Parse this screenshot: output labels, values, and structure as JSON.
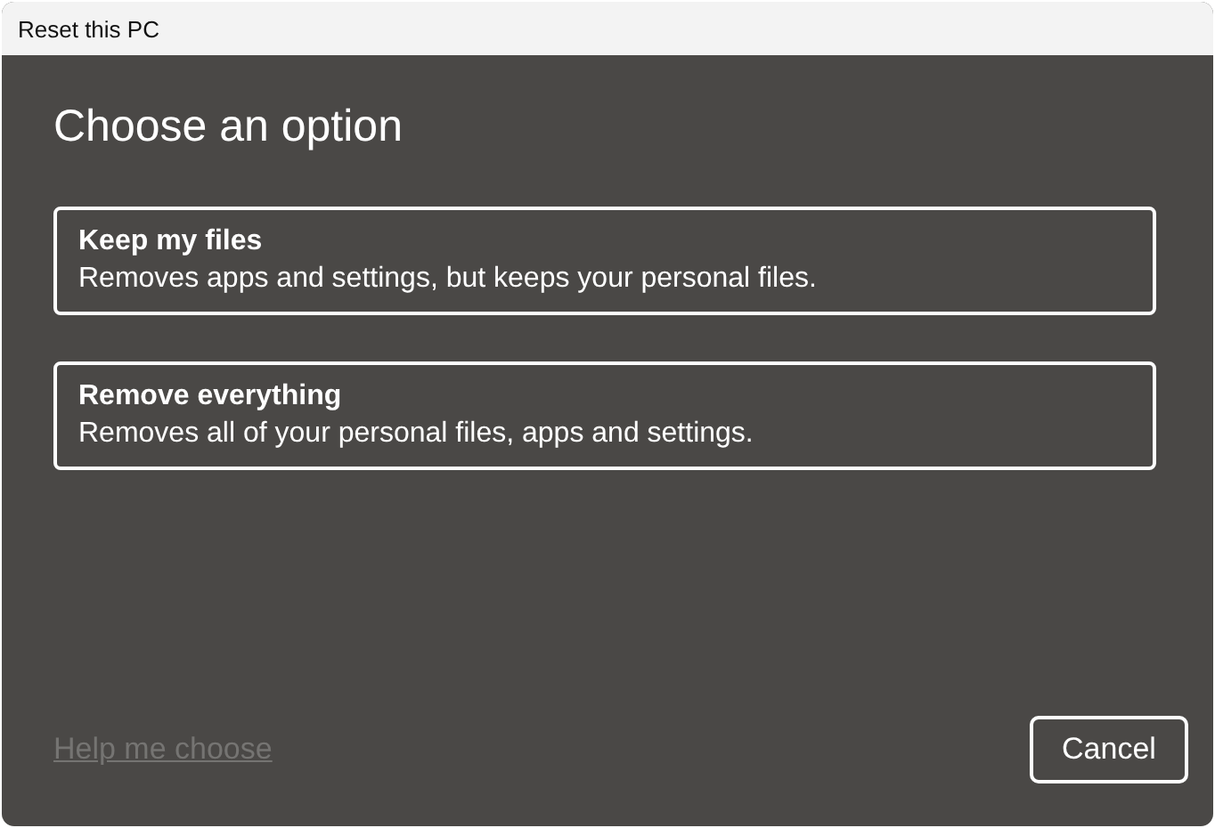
{
  "window": {
    "title": "Reset this PC"
  },
  "heading": "Choose an option",
  "options": [
    {
      "title": "Keep my files",
      "description": "Removes apps and settings, but keeps your personal files."
    },
    {
      "title": "Remove everything",
      "description": "Removes all of your personal files, apps and settings."
    }
  ],
  "help_link": {
    "label": "Help me choose",
    "disabled": true
  },
  "buttons": [
    "Cancel"
  ]
}
